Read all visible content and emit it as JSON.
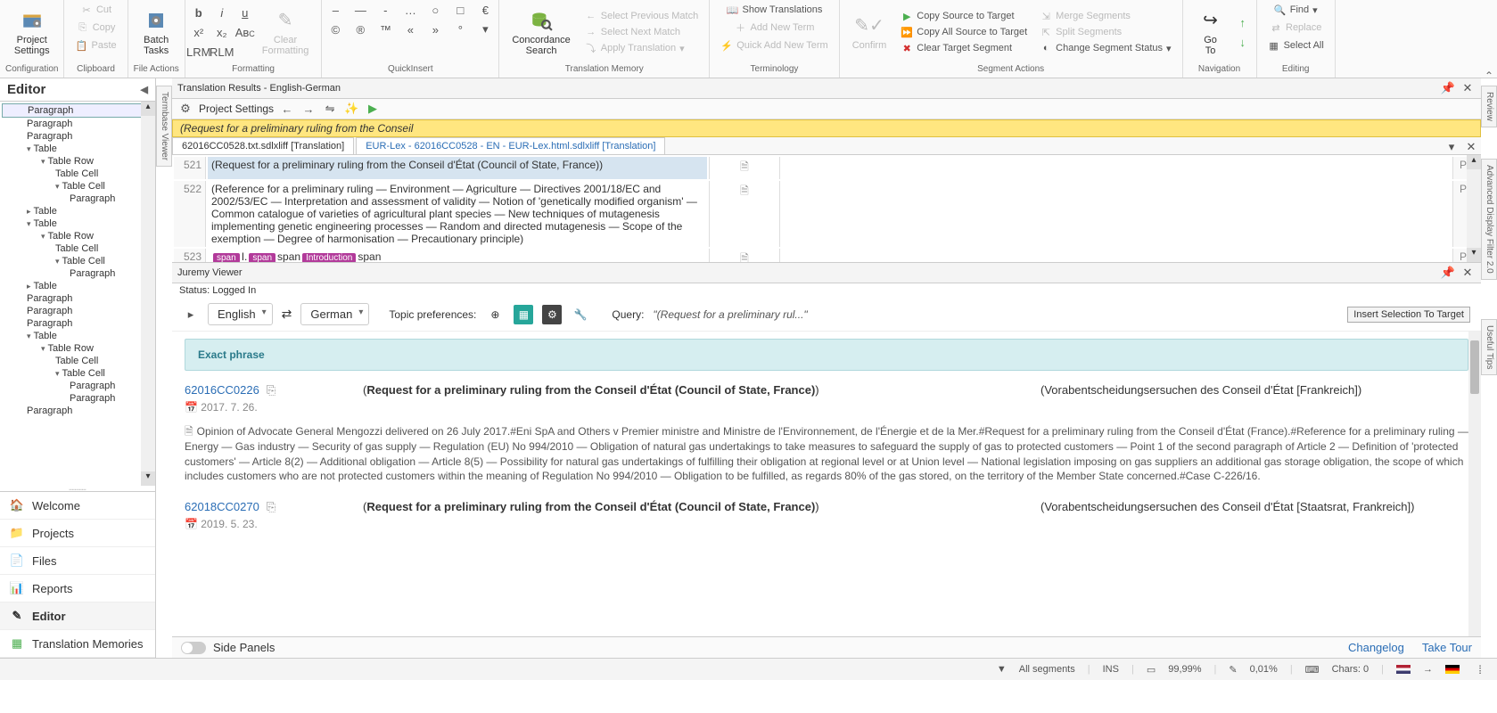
{
  "ribbon": {
    "configuration": {
      "project_settings": "Project\nSettings",
      "group": "Configuration"
    },
    "clipboard": {
      "cut": "Cut",
      "copy": "Copy",
      "paste": "Paste",
      "group": "Clipboard"
    },
    "file_actions": {
      "batch_tasks": "Batch\nTasks",
      "group": "File Actions"
    },
    "formatting": {
      "clear_formatting": "Clear\nFormatting",
      "group": "Formatting"
    },
    "quickinsert": {
      "group": "QuickInsert"
    },
    "translation_memory": {
      "concordance": "Concordance\nSearch",
      "select_prev": "Select Previous Match",
      "select_next": "Select Next Match",
      "apply_translation": "Apply Translation",
      "group": "Translation Memory"
    },
    "terminology": {
      "show_translations": "Show Translations",
      "add_new_term": "Add New Term",
      "quick_add": "Quick Add New Term",
      "group": "Terminology"
    },
    "segment_actions": {
      "confirm": "Confirm",
      "copy_source": "Copy Source to Target",
      "copy_all": "Copy All Source to Target",
      "clear_target": "Clear Target Segment",
      "merge": "Merge Segments",
      "split": "Split Segments",
      "change_status": "Change Segment Status",
      "group": "Segment Actions"
    },
    "navigation": {
      "goto": "Go\nTo",
      "group": "Navigation"
    },
    "editing": {
      "find": "Find",
      "replace": "Replace",
      "select_all": "Select All",
      "group": "Editing"
    }
  },
  "editor_panel": {
    "title": "Editor"
  },
  "tree": [
    {
      "label": "Paragraph",
      "indent": 1,
      "sel": true
    },
    {
      "label": "Paragraph",
      "indent": 1
    },
    {
      "label": "Paragraph",
      "indent": 1
    },
    {
      "label": "Table",
      "indent": 1,
      "toggle": "open"
    },
    {
      "label": "Table Row",
      "indent": 2,
      "toggle": "open"
    },
    {
      "label": "Table Cell",
      "indent": 3
    },
    {
      "label": "Table Cell",
      "indent": 3,
      "toggle": "open"
    },
    {
      "label": "Paragraph",
      "indent": 4
    },
    {
      "label": "Table",
      "indent": 1,
      "toggle": "closed"
    },
    {
      "label": "Table",
      "indent": 1,
      "toggle": "open"
    },
    {
      "label": "Table Row",
      "indent": 2,
      "toggle": "open"
    },
    {
      "label": "Table Cell",
      "indent": 3
    },
    {
      "label": "Table Cell",
      "indent": 3,
      "toggle": "open"
    },
    {
      "label": "Paragraph",
      "indent": 4
    },
    {
      "label": "Table",
      "indent": 1,
      "toggle": "closed"
    },
    {
      "label": "Paragraph",
      "indent": 1
    },
    {
      "label": "Paragraph",
      "indent": 1
    },
    {
      "label": "Paragraph",
      "indent": 1
    },
    {
      "label": "Table",
      "indent": 1,
      "toggle": "open"
    },
    {
      "label": "Table Row",
      "indent": 2,
      "toggle": "open"
    },
    {
      "label": "Table Cell",
      "indent": 3
    },
    {
      "label": "Table Cell",
      "indent": 3,
      "toggle": "open"
    },
    {
      "label": "Paragraph",
      "indent": 4
    },
    {
      "label": "Paragraph",
      "indent": 4
    },
    {
      "label": "Paragraph",
      "indent": 1
    }
  ],
  "nav": {
    "welcome": "Welcome",
    "projects": "Projects",
    "files": "Files",
    "reports": "Reports",
    "editor": "Editor",
    "tm": "Translation Memories"
  },
  "vert_tabs": {
    "left": "Termbase Viewer",
    "right_top": "Review",
    "right_bot": "Advanced Display Filter 2.0",
    "right_useful": "Useful Tips"
  },
  "results_panel": {
    "title": "Translation Results - English-German",
    "project_settings": "Project Settings",
    "search_text": "(Request for a preliminary ruling from the Conseil"
  },
  "tabs": {
    "t1": "62016CC0528.txt.sdlxliff [Translation]",
    "t2": "EUR-Lex - 62016CC0528 - EN - EUR-Lex.html.sdlxliff [Translation]"
  },
  "segments": [
    {
      "num": "521",
      "src": "(Request for a preliminary ruling from the Conseil d'État (Council of State, France))",
      "status": "P+",
      "sel": true,
      "icon": "doc"
    },
    {
      "num": "522",
      "src": "(Reference for a preliminary ruling — Environment — Agriculture — Directives 2001/18/EC and 2002/53/EC — Interpretation and assessment of validity — Notion of 'genetically modified organism' — Common catalogue of varieties of agricultural plant species — New techniques of mutagenesis implementing genetic engineering processes — Random and directed mutagenesis — Scope of the exemption — Degree of harmonisation — Precautionary principle)",
      "status": "P+",
      "icon": "doc"
    },
    {
      "num": "523",
      "src_tags": [
        "span",
        "I.",
        "span",
        "span",
        "Introduction",
        "span"
      ],
      "status": "P+",
      "icon": "doc"
    }
  ],
  "juremy": {
    "title": "Juremy Viewer",
    "status": "Status: Logged In",
    "lang_src": "English",
    "lang_tgt": "German",
    "topic_label": "Topic preferences:",
    "query_label": "Query:",
    "query_text": "\"(Request for a preliminary rul...\"",
    "insert_btn": "Insert Selection To Target",
    "exact_header": "Exact phrase",
    "results": [
      {
        "id": "62016CC0226",
        "date": "2017. 7. 26.",
        "src": "(Request for a preliminary ruling from the Conseil d'État (Council of State, France))",
        "tgt": "(Vorabentscheidungsersuchen des Conseil d'État [Frankreich])",
        "body": "Opinion of Advocate General Mengozzi delivered on 26 July 2017.#Eni SpA and Others v Premier ministre and Ministre de l'Environnement, de l'Énergie et de la Mer.#Request for a preliminary ruling from the Conseil d'État (France).#Reference for a preliminary ruling — Energy — Gas industry — Security of gas supply — Regulation (EU) No 994/2010 — Obligation of natural gas undertakings to take measures to safeguard the supply of gas to protected customers — Point 1 of the second paragraph of Article 2 — Definition of 'protected customers' — Article 8(2) — Additional obligation — Article 8(5) — Possibility for natural gas undertakings of fulfilling their obligation at regional level or at Union level — National legislation imposing on gas suppliers an additional gas storage obligation, the scope of which includes customers who are not protected customers within the meaning of Regulation No 994/2010 — Obligation to be fulfilled, as regards 80% of the gas stored, on the territory of the Member State concerned.#Case C-226/16."
      },
      {
        "id": "62018CC0270",
        "date": "2019. 5. 23.",
        "src": "(Request for a preliminary ruling from the Conseil d'État (Council of State, France))",
        "tgt": "(Vorabentscheidungsersuchen des Conseil d'État [Staatsrat, Frankreich])"
      }
    ]
  },
  "footer": {
    "side_panels": "Side Panels",
    "changelog": "Changelog",
    "take_tour": "Take Tour"
  },
  "statusbar": {
    "all_segments": "All segments",
    "ins": "INS",
    "pct1": "99,99%",
    "pct2": "0,01%",
    "chars": "Chars: 0"
  }
}
